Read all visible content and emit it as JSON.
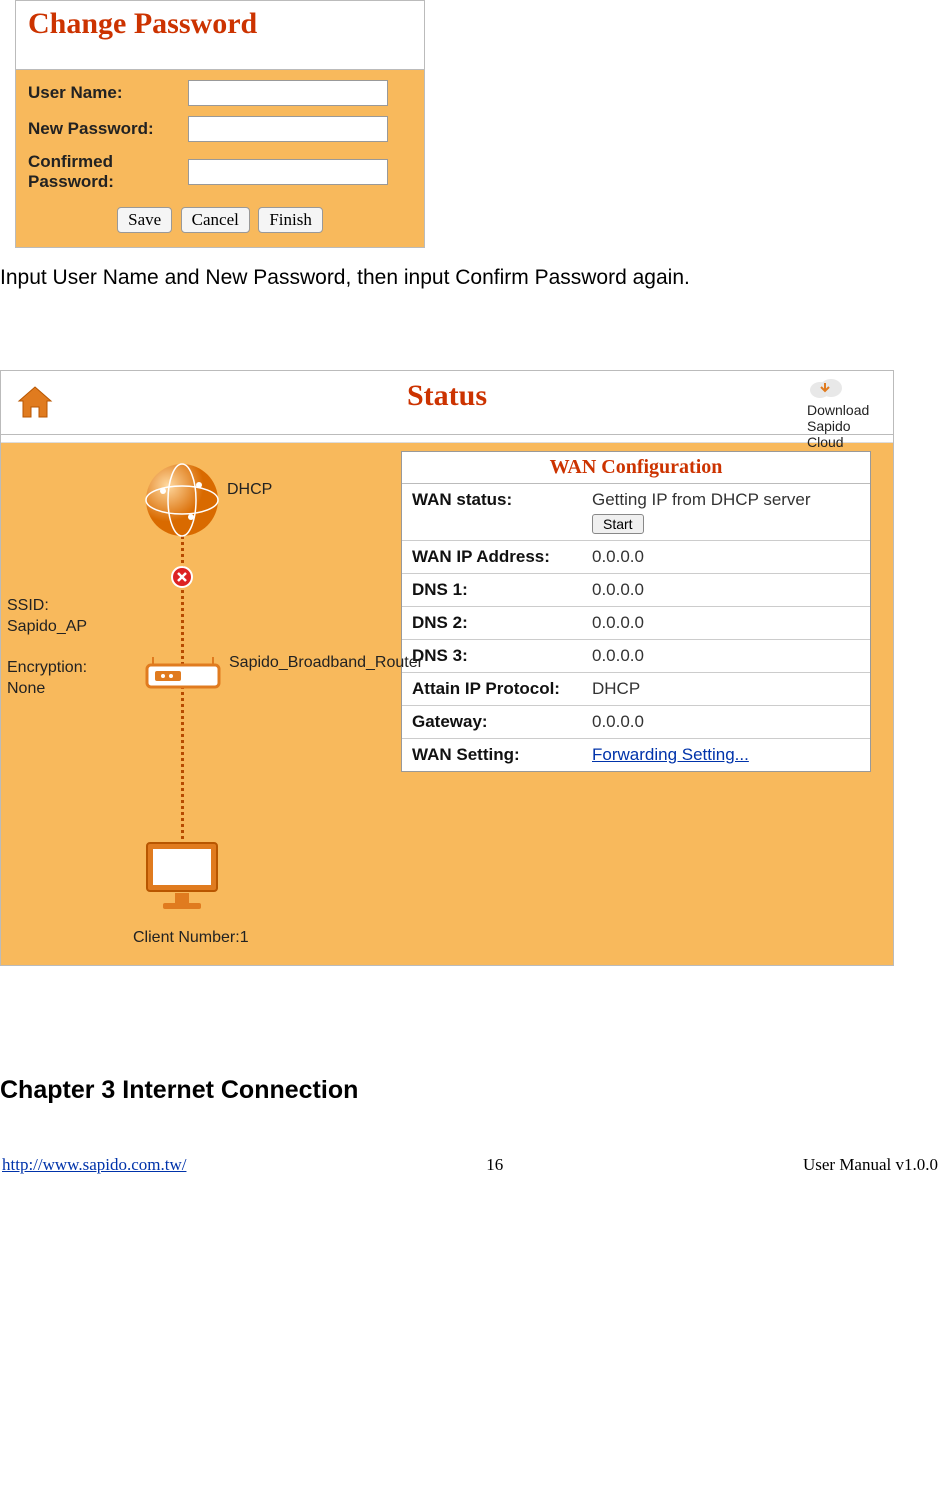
{
  "change_password": {
    "title": "Change Password",
    "user_name_label": "User Name:",
    "new_password_label": "New Password:",
    "confirmed_password_label": "Confirmed Password:",
    "save": "Save",
    "cancel": "Cancel",
    "finish": "Finish"
  },
  "instruction": "Input User Name and New Password, then input Confirm Password again.",
  "status": {
    "title": "Status",
    "cloud": "Download Sapido Cloud",
    "dhcp_label": "DHCP",
    "ssid_label": "SSID:",
    "ssid_value": "Sapido_AP",
    "encryption_label": "Encryption:",
    "encryption_value": "None",
    "router_label": "Sapido_Broadband_Router",
    "client_label": "Client Number:1"
  },
  "wan": {
    "header": "WAN Configuration",
    "rows": {
      "status_k": "WAN status:",
      "status_v": "Getting IP from DHCP server",
      "start": "Start",
      "ip_k": "WAN IP Address:",
      "ip_v": "0.0.0.0",
      "dns1_k": "DNS 1:",
      "dns1_v": "0.0.0.0",
      "dns2_k": "DNS 2:",
      "dns2_v": "0.0.0.0",
      "dns3_k": "DNS 3:",
      "dns3_v": "0.0.0.0",
      "proto_k": "Attain IP Protocol:",
      "proto_v": "DHCP",
      "gw_k": "Gateway:",
      "gw_v": "0.0.0.0",
      "set_k": "WAN Setting:",
      "set_v": "Forwarding Setting..."
    }
  },
  "chapter": "Chapter 3    Internet Connection",
  "footer": {
    "url": "http://www.sapido.com.tw/",
    "page": "16",
    "version": "User  Manual  v1.0.0"
  }
}
